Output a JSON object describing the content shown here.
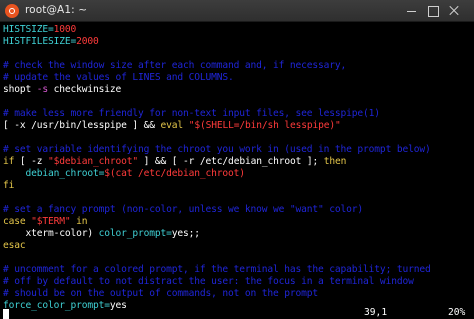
{
  "window": {
    "title": "root@A1: ~",
    "app_icon": "ubuntu-terminal-icon",
    "controls": [
      "minimize-icon",
      "maximize-icon",
      "close-icon"
    ]
  },
  "terminal": {
    "lines": [
      {
        "segments": [
          {
            "text": "HISTSIZE=",
            "color": "cyan"
          },
          {
            "text": "1000",
            "color": "red"
          }
        ]
      },
      {
        "segments": [
          {
            "text": "HISTFILESIZE=",
            "color": "cyan"
          },
          {
            "text": "2000",
            "color": "red"
          }
        ]
      },
      {
        "segments": [
          {
            "text": "",
            "color": "blue"
          }
        ]
      },
      {
        "segments": [
          {
            "text": "# check the window size after each command and, if necessary,",
            "color": "blue"
          }
        ]
      },
      {
        "segments": [
          {
            "text": "# update the values of LINES and COLUMNS.",
            "color": "blue"
          }
        ]
      },
      {
        "segments": [
          {
            "text": "shopt ",
            "color": "white"
          },
          {
            "text": "-s",
            "color": "magenta"
          },
          {
            "text": " checkwinsize",
            "color": "white"
          }
        ]
      },
      {
        "segments": [
          {
            "text": "",
            "color": "blue"
          }
        ]
      },
      {
        "segments": [
          {
            "text": "# make less more friendly for non-text input files, see lesspipe(1)",
            "color": "blue"
          }
        ]
      },
      {
        "segments": [
          {
            "text": "[ -x /usr/bin/lesspipe ] && ",
            "color": "white"
          },
          {
            "text": "eval",
            "color": "yellow"
          },
          {
            "text": " ",
            "color": "white"
          },
          {
            "text": "\"$(SHELL=/bin/sh lesspipe)\"",
            "color": "red"
          }
        ]
      },
      {
        "segments": [
          {
            "text": "",
            "color": "blue"
          }
        ]
      },
      {
        "segments": [
          {
            "text": "# set variable identifying the chroot you work in (used in the prompt below)",
            "color": "blue"
          }
        ]
      },
      {
        "segments": [
          {
            "text": "if",
            "color": "yellow"
          },
          {
            "text": " [ -z ",
            "color": "white"
          },
          {
            "text": "\"$debian_chroot\"",
            "color": "red"
          },
          {
            "text": " ] && [ -r /etc/debian_chroot ]; ",
            "color": "white"
          },
          {
            "text": "then",
            "color": "yellow"
          }
        ]
      },
      {
        "segments": [
          {
            "text": "    ",
            "color": "white"
          },
          {
            "text": "debian_chroot=",
            "color": "cyan"
          },
          {
            "text": "$(cat /etc/debian_chroot)",
            "color": "red"
          }
        ]
      },
      {
        "segments": [
          {
            "text": "fi",
            "color": "yellow"
          }
        ]
      },
      {
        "segments": [
          {
            "text": "",
            "color": "blue"
          }
        ]
      },
      {
        "segments": [
          {
            "text": "# set a fancy prompt (non-color, unless we know we \"want\" color)",
            "color": "blue"
          }
        ]
      },
      {
        "segments": [
          {
            "text": "case",
            "color": "yellow"
          },
          {
            "text": " ",
            "color": "white"
          },
          {
            "text": "\"$TERM\"",
            "color": "red"
          },
          {
            "text": " in",
            "color": "yellow"
          }
        ]
      },
      {
        "segments": [
          {
            "text": "    xterm-color) ",
            "color": "white"
          },
          {
            "text": "color_prompt=",
            "color": "cyan"
          },
          {
            "text": "yes;;",
            "color": "white"
          }
        ]
      },
      {
        "segments": [
          {
            "text": "esac",
            "color": "yellow"
          }
        ]
      },
      {
        "segments": [
          {
            "text": "",
            "color": "blue"
          }
        ]
      },
      {
        "segments": [
          {
            "text": "# uncomment for a colored prompt, if the terminal has the capability; turned",
            "color": "blue"
          }
        ]
      },
      {
        "segments": [
          {
            "text": "# off by default to not distract the user: the focus in a terminal window",
            "color": "blue"
          }
        ]
      },
      {
        "segments": [
          {
            "text": "# should be on the output of commands, not on the prompt",
            "color": "blue"
          }
        ]
      },
      {
        "segments": [
          {
            "text": "force_color_prompt=",
            "color": "cyan"
          },
          {
            "text": "yes",
            "color": "white"
          }
        ]
      }
    ],
    "status": {
      "position": "39,1",
      "percent": "20%"
    }
  },
  "colors": {
    "background": "#000000",
    "blue": "#1f25d7",
    "white": "#ffffff",
    "red": "#ff3b3b",
    "yellow": "#e4c64a",
    "magenta": "#d85ad3",
    "cyan": "#3fd0d4"
  }
}
